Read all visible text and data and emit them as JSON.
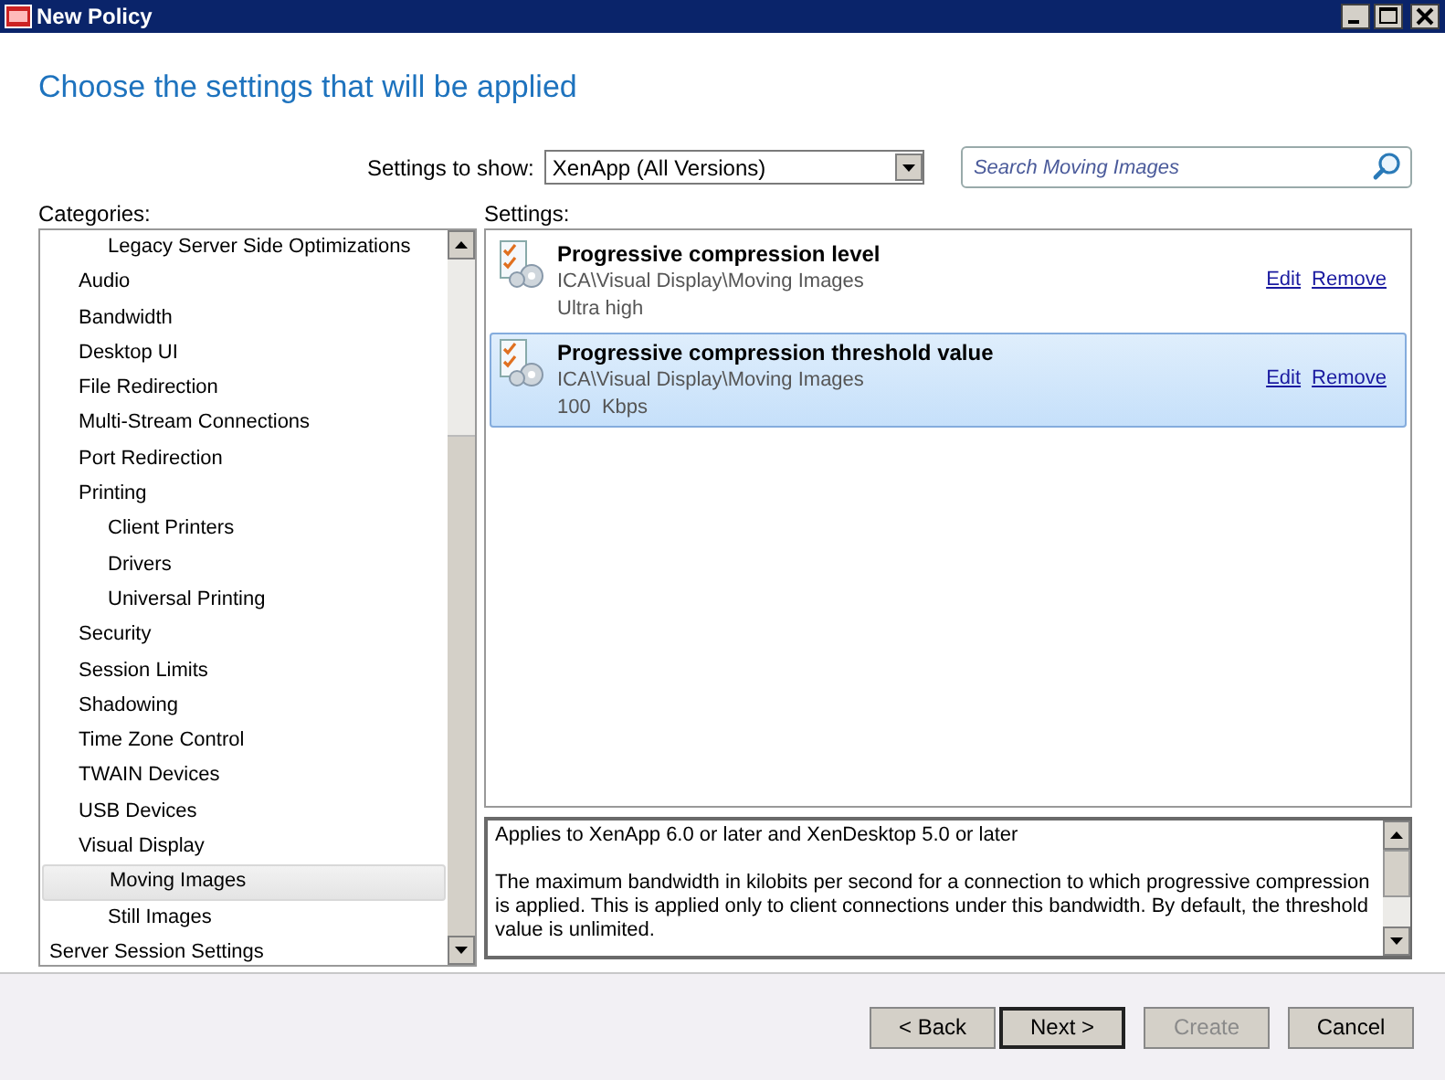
{
  "window": {
    "title": "New Policy"
  },
  "heading": "Choose the settings that will be applied",
  "filter": {
    "label": "Settings to show:",
    "value": "XenApp (All Versions)"
  },
  "search": {
    "placeholder": "Search Moving Images"
  },
  "categories": {
    "label": "Categories:",
    "items": [
      {
        "children": [
          {
            "children": [
              {
                "label": "Legacy Server Side Optimizations",
                "selected": false
              }
            ]
          },
          {
            "label": "Audio",
            "selected": false
          },
          {
            "label": "Bandwidth",
            "selected": false
          },
          {
            "label": "Desktop UI",
            "selected": false
          },
          {
            "label": "File Redirection",
            "selected": false
          },
          {
            "label": "Multi-Stream Connections",
            "selected": false
          },
          {
            "label": "Port Redirection",
            "selected": false
          },
          {
            "label": "Printing",
            "selected": false,
            "children": [
              {
                "label": "Client Printers",
                "selected": false
              },
              {
                "label": "Drivers",
                "selected": false
              },
              {
                "label": "Universal Printing",
                "selected": false
              }
            ]
          },
          {
            "label": "Security",
            "selected": false
          },
          {
            "label": "Session Limits",
            "selected": false
          },
          {
            "label": "Shadowing",
            "selected": false
          },
          {
            "label": "Time Zone Control",
            "selected": false
          },
          {
            "label": "TWAIN Devices",
            "selected": false
          },
          {
            "label": "USB Devices",
            "selected": false
          },
          {
            "label": "Visual Display",
            "selected": false,
            "children": [
              {
                "label": "Moving Images",
                "selected": true
              },
              {
                "label": "Still Images",
                "selected": false
              }
            ]
          }
        ]
      },
      {
        "label": "Server Session Settings",
        "selected": false
      }
    ]
  },
  "settings": {
    "label": "Settings:",
    "items": [
      {
        "title": "Progressive compression level",
        "path": "ICA\\Visual Display\\Moving Images",
        "value": "Ultra high",
        "edit": "Edit",
        "remove": "Remove",
        "selected": false
      },
      {
        "title": "Progressive compression threshold value",
        "path": "ICA\\Visual Display\\Moving Images",
        "value": "100  Kbps",
        "edit": "Edit",
        "remove": "Remove",
        "selected": true
      }
    ]
  },
  "description": {
    "applies": "Applies to XenApp 6.0 or later and XenDesktop 5.0 or later",
    "text": "The maximum bandwidth in kilobits per second for a connection to which progressive compression is applied. This is applied only to client connections under this bandwidth. By default, the threshold value is unlimited."
  },
  "buttons": [
    {
      "label": "< Back",
      "disabled": false,
      "default": false
    },
    {
      "label": "Next >",
      "disabled": false,
      "default": true
    },
    {
      "label": "Create",
      "disabled": true,
      "default": false
    },
    {
      "label": "Cancel",
      "disabled": false,
      "default": false
    }
  ]
}
